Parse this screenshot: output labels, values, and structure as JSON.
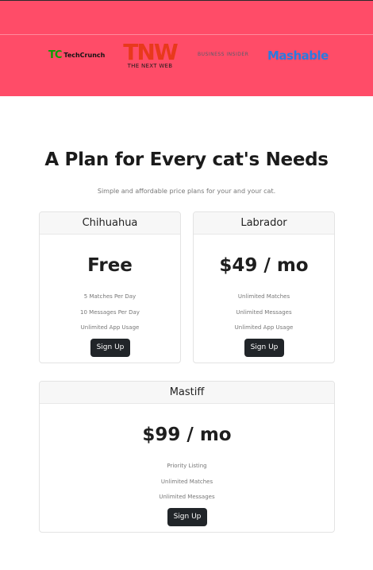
{
  "press": {
    "logos": [
      {
        "name": "TechCrunch",
        "mark": "TC",
        "word": "TechCrunch"
      },
      {
        "name": "The Next Web",
        "mark": "TNW",
        "word": "THE NEXT WEB"
      },
      {
        "name": "Business Insider",
        "word": "BUSINESS INSIDER"
      },
      {
        "name": "Mashable",
        "word": "Mashable"
      }
    ],
    "colors": {
      "band": "#ff4c68",
      "techcrunch": "#0a9e01",
      "tnw": "#e8391c",
      "mashable": "#2a7ae0"
    }
  },
  "pricing": {
    "title": "A Plan for Every cat's Needs",
    "subtitle": "Simple and affordable price plans for your and your cat.",
    "plans": [
      {
        "name": "Chihuahua",
        "price": "Free",
        "features": [
          "5 Matches Per Day",
          "10 Messages Per Day",
          "Unlimited App Usage"
        ],
        "cta": "Sign Up"
      },
      {
        "name": "Labrador",
        "price": "$49 / mo",
        "features": [
          "Unlimited Matches",
          "Unlimited Messages",
          "Unlimited App Usage"
        ],
        "cta": "Sign Up"
      },
      {
        "name": "Mastiff",
        "price": "$99 / mo",
        "features": [
          "Priority Listing",
          "Unlimited Matches",
          "Unlimited Messages"
        ],
        "cta": "Sign Up"
      }
    ],
    "colors": {
      "button": "#212529",
      "card_header": "#f7f7f7"
    }
  }
}
